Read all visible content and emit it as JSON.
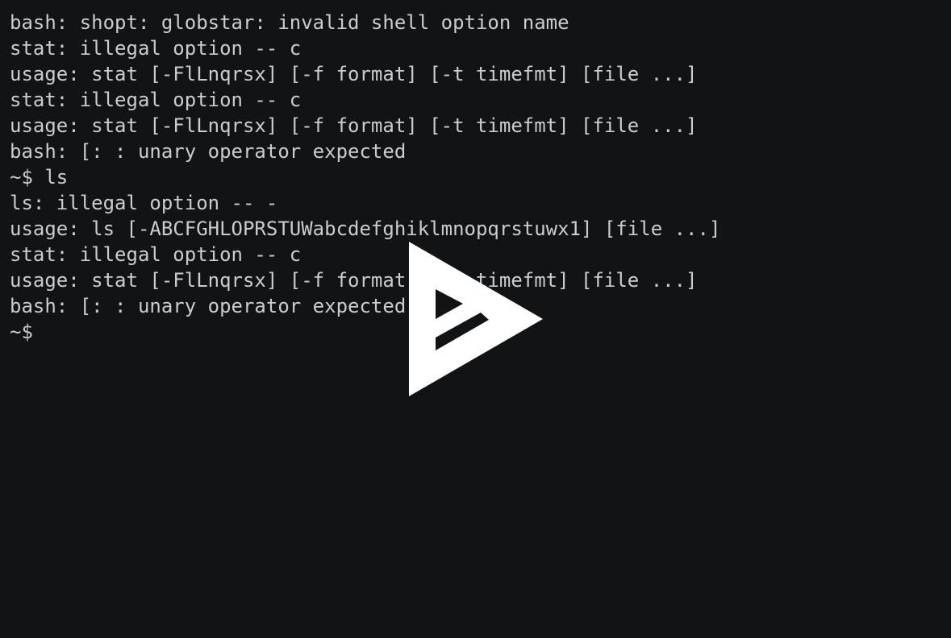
{
  "terminal": {
    "lines": [
      "bash: shopt: globstar: invalid shell option name",
      "stat: illegal option -- c",
      "usage: stat [-FlLnqrsx] [-f format] [-t timefmt] [file ...]",
      "stat: illegal option -- c",
      "usage: stat [-FlLnqrsx] [-f format] [-t timefmt] [file ...]",
      "bash: [: : unary operator expected",
      "~$ ls",
      "ls: illegal option -- -",
      "usage: ls [-ABCFGHLOPRSTUWabcdefghiklmnopqrstuwx1] [file ...]",
      "stat: illegal option -- c",
      "usage: stat [-FlLnqrsx] [-f format] [-t timefmt] [file ...]",
      "bash: [: : unary operator expected",
      "~$"
    ]
  },
  "overlay": {
    "icon": "asciinema-play-icon",
    "color": "#ffffff",
    "background": "#121314"
  }
}
